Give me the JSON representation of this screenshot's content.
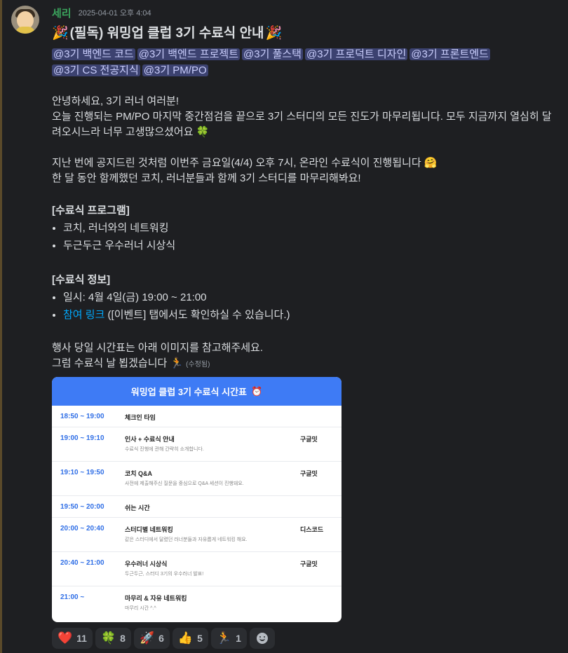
{
  "message": {
    "author": "세리",
    "timestamp": "2025-04-01 오후 4:04",
    "title_emoji": "🎉",
    "title": "(필독) 워밍업 클럽 3기 수료식 안내",
    "mentions": [
      "@3기 백엔드 코드",
      "@3기 백엔드 프로젝트",
      "@3기 풀스택",
      "@3기 프로덕트 디자인",
      "@3기 프론트엔드",
      "@3기 CS 전공지식",
      "@3기 PM/PO"
    ],
    "greeting": "안녕하세요, 3기 러너 여러분!",
    "intro": "오늘 진행되는 PM/PO 마지막 중간점검을 끝으로 3기 스터디의 모든 진도가 마무리됩니다. 모두 지금까지 열심히 달려오시느라 너무 고생많으셨어요",
    "intro_emoji": "🍀",
    "notice": "지난 번에 공지드린 것처럼 이번주 금요일(4/4) 오후 7시, 온라인 수료식이 진행됩니다",
    "notice_emoji": "🤗",
    "notice2": "한 달 동안 함께했던 코치, 러너분들과 함께 3기 스터디를 마무리해봐요!",
    "program_heading": "[수료식 프로그램]",
    "program_items": [
      "코치, 러너와의 네트워킹",
      "두근두근 우수러너 시상식"
    ],
    "info_heading": "[수료식 정보]",
    "info_date": "일시: 4월 4일(금) 19:00 ~ 21:00",
    "info_link": "참여 링크",
    "info_link_rest": " ([이벤트] 탭에서도 확인하실 수 있습니다.)",
    "closing1": "행사 당일 시간표는 아래 이미지를 참고해주세요.",
    "closing2": "그럼 수료식 날 뵙겠습니다",
    "closing_emoji": "🏃",
    "edited": "(수정됨)"
  },
  "schedule": {
    "title": "워밍업 클럽 3기 수료식 시간표",
    "title_emoji": "⏰",
    "rows": [
      {
        "time": "18:50 ~ 19:00",
        "title": "체크인 타임",
        "desc": "",
        "loc": ""
      },
      {
        "time": "19:00 ~ 19:10",
        "title": "인사 + 수료식 안내",
        "desc": "수료식 진행에 관해 간략히 소개합니다.",
        "loc": "구글밋"
      },
      {
        "time": "19:10 ~ 19:50",
        "title": "코치 Q&A",
        "desc": "사전에 제출해주신 질문을 중심으로 Q&A 세션이 진행돼요.",
        "loc": "구글밋"
      },
      {
        "time": "19:50 ~ 20:00",
        "title": "쉬는 시간",
        "desc": "",
        "loc": ""
      },
      {
        "time": "20:00 ~ 20:40",
        "title": "스터디별 네트워킹",
        "desc": "같은 스터디에서 달렸던 러너분들과 자유롭게 네트워킹 해요.",
        "loc": "디스코드"
      },
      {
        "time": "20:40 ~ 21:00",
        "title": "우수러너 시상식",
        "desc": "두근두근, 스터디 3기의 우수러너 발표!",
        "loc": "구글밋"
      },
      {
        "time": "21:00 ~",
        "title": "마무리 & 자유 네트워킹",
        "desc": "마무리 시간 ^.^",
        "loc": ""
      }
    ]
  },
  "reactions": [
    {
      "emoji": "❤️",
      "count": "11",
      "icon": "heart-icon"
    },
    {
      "emoji": "🍀",
      "count": "8",
      "icon": "clover-icon"
    },
    {
      "emoji": "🚀",
      "count": "6",
      "icon": "rocket-icon"
    },
    {
      "emoji": "👍",
      "count": "5",
      "icon": "thumbs-up-icon"
    },
    {
      "emoji": "🏃",
      "count": "1",
      "icon": "runner-icon"
    }
  ],
  "colors": {
    "background": "#1e1f22",
    "author": "#3ba55d",
    "mention_bg": "#3c4270",
    "link": "#00a8fc",
    "schedule_header": "#3e7bf5"
  }
}
